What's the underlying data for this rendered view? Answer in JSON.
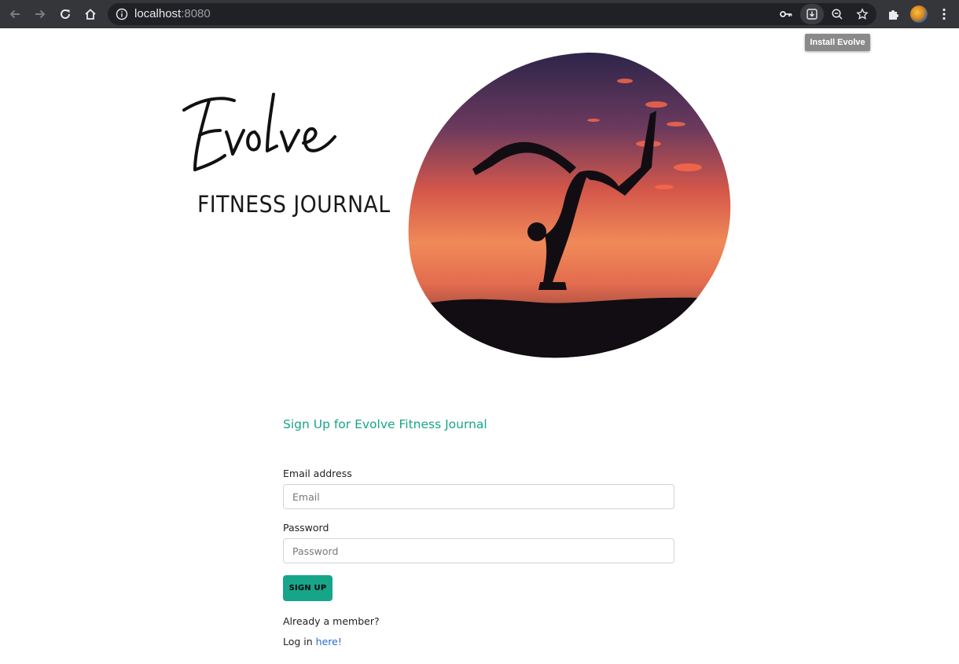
{
  "browser": {
    "url_host": "localhost",
    "url_port": ":8080",
    "tooltip": "Install Evolve",
    "icons": [
      "back-icon",
      "forward-icon",
      "reload-icon",
      "home-icon",
      "info-icon",
      "key-icon",
      "install-icon",
      "zoom-icon",
      "star-icon",
      "extensions-icon",
      "profile-avatar",
      "menu-icon"
    ]
  },
  "hero": {
    "logo_text": "Evolve",
    "logo_subtitle": "FITNESS JOURNAL"
  },
  "form": {
    "title": "Sign Up for Evolve Fitness Journal",
    "email_label": "Email address",
    "email_placeholder": "Email",
    "email_value": "",
    "password_label": "Password",
    "password_placeholder": "Password",
    "password_value": "",
    "submit_label": "SIGN UP",
    "member_text": "Already a member?",
    "login_prefix": "Log in ",
    "login_link": "here!"
  },
  "colors": {
    "accent": "#17a589",
    "link": "#2a6bd1",
    "toolbar": "#35363a"
  }
}
